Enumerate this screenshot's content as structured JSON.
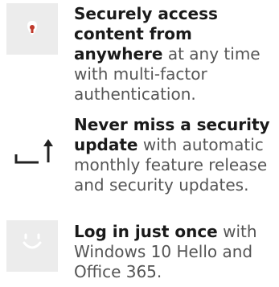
{
  "features": [
    {
      "icon": "shield-lock-icon",
      "bold": "Securely access content from anywhere",
      "rest": " at any time with multi-factor authentication."
    },
    {
      "icon": "update-arrow-icon",
      "bold": "Never miss a security update",
      "rest": " with automatic monthly feature release and security updates."
    },
    {
      "icon": "windows-hello-face-icon",
      "bold": "Log in just once",
      "rest": " with Windows 10 Hello and Office 365."
    }
  ],
  "colors": {
    "icon_bg": "#ececec",
    "accent_red": "#c0392b",
    "icon_dark": "#222222",
    "face_white": "#ffffff"
  }
}
